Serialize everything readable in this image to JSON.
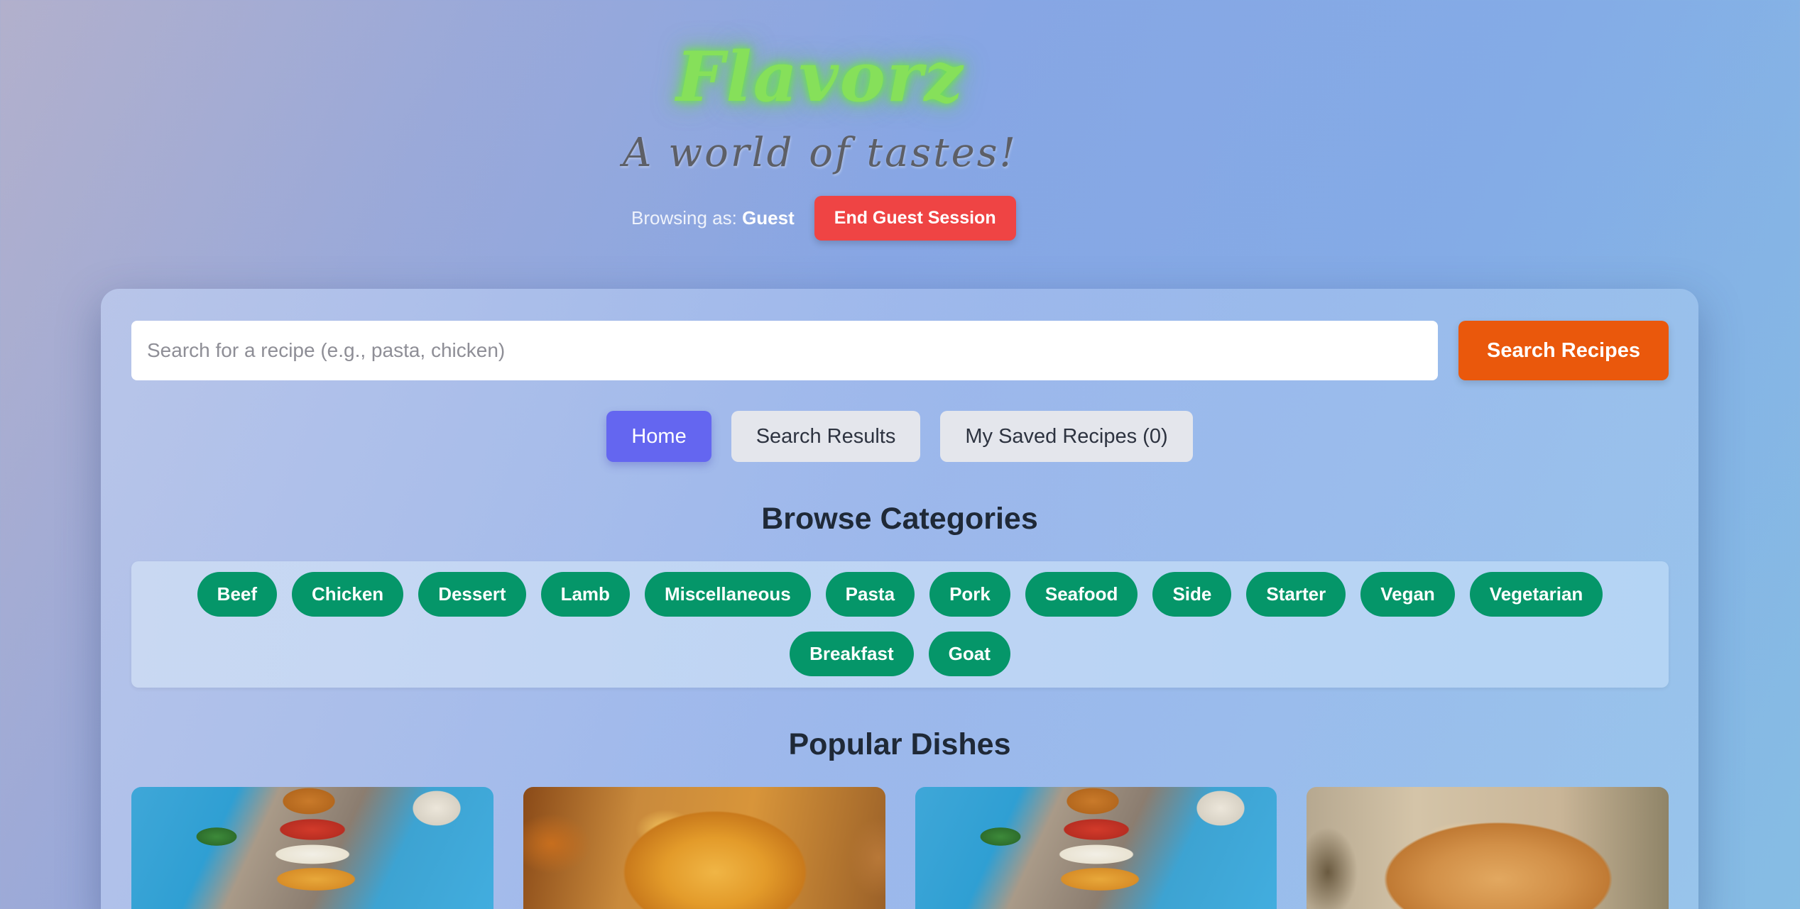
{
  "header": {
    "logo": "Flavorz",
    "tagline": "A world of tastes!",
    "browsing_label": "Browsing as:",
    "browsing_user": "Guest",
    "end_session_label": "End Guest Session"
  },
  "search": {
    "placeholder": "Search for a recipe (e.g., pasta, chicken)",
    "value": "",
    "button_label": "Search Recipes"
  },
  "tabs": [
    {
      "label": "Home",
      "active": true
    },
    {
      "label": "Search Results",
      "active": false
    },
    {
      "label": "My Saved Recipes (0)",
      "active": false
    }
  ],
  "categories": {
    "title": "Browse Categories",
    "items": [
      "Beef",
      "Chicken",
      "Dessert",
      "Lamb",
      "Miscellaneous",
      "Pasta",
      "Pork",
      "Seafood",
      "Side",
      "Starter",
      "Vegan",
      "Vegetarian",
      "Breakfast",
      "Goat"
    ]
  },
  "popular": {
    "title": "Popular Dishes",
    "dishes": [
      {
        "image": "burger-image"
      },
      {
        "image": "pie-image"
      },
      {
        "image": "burger-image"
      },
      {
        "image": "sandwich-image"
      }
    ]
  },
  "colors": {
    "logo": "#86e05a",
    "end_session": "#ef4444",
    "search_button": "#ea580c",
    "active_tab": "#6466f0",
    "category_pill": "#059669"
  }
}
